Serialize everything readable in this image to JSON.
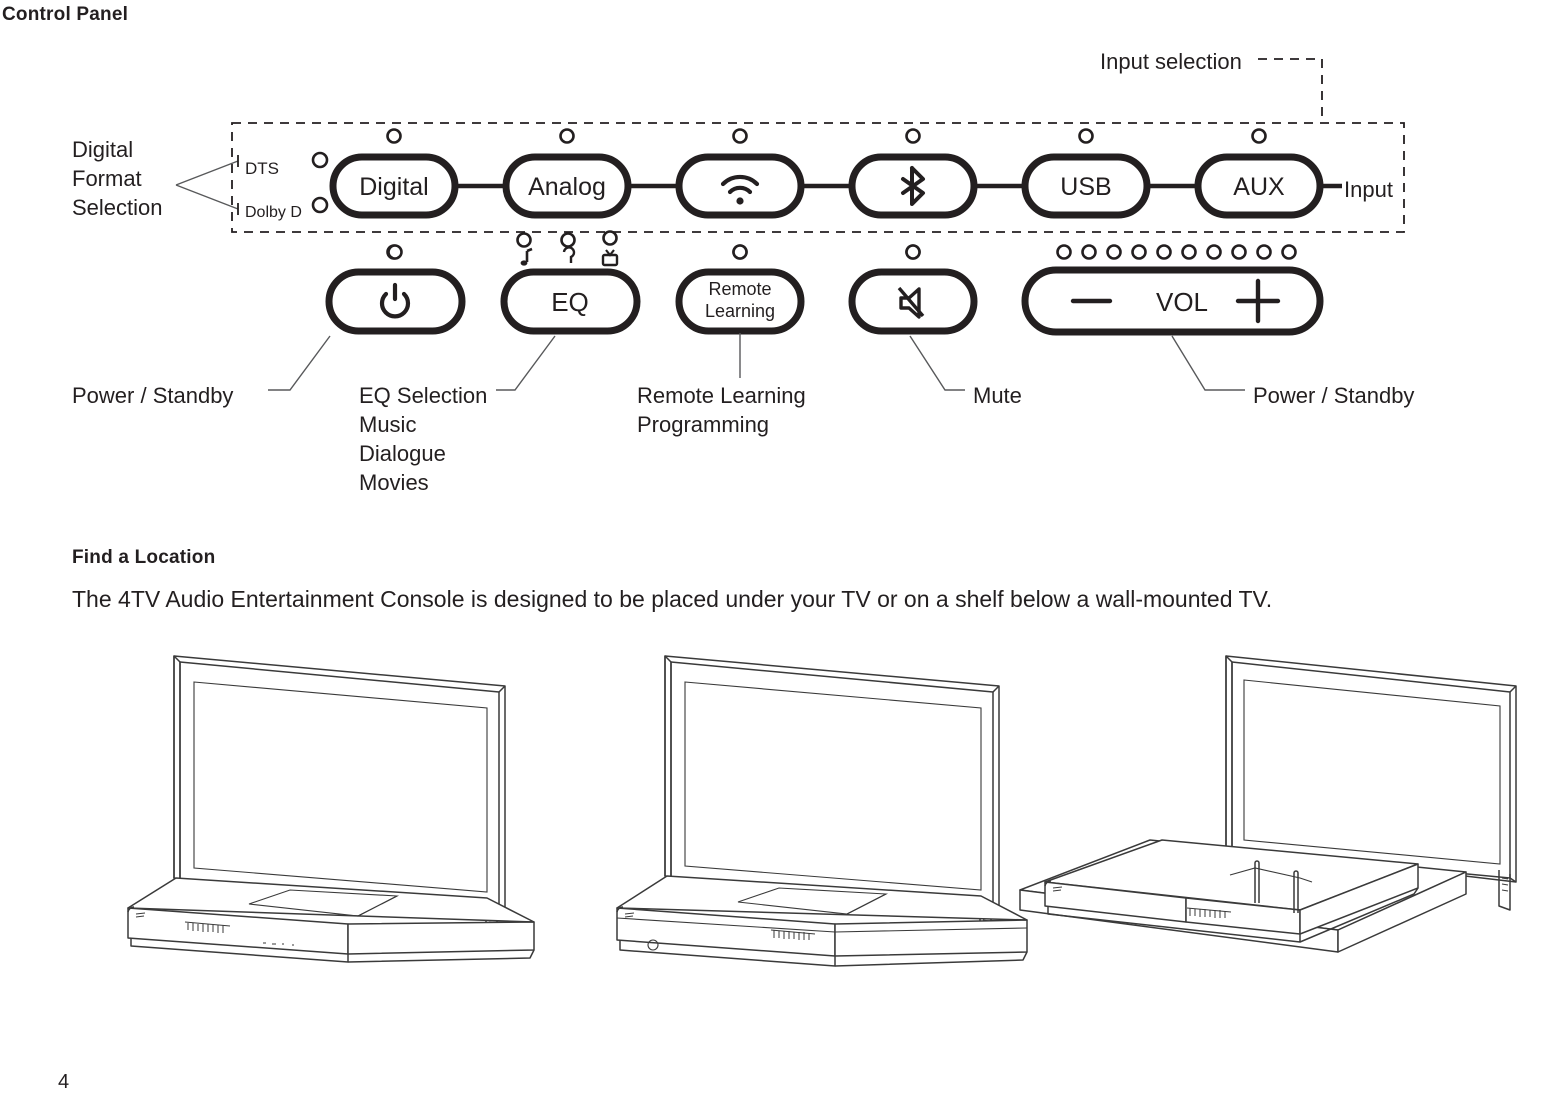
{
  "page": {
    "number": "4"
  },
  "sections": {
    "control_panel": {
      "heading": "Control Panel"
    },
    "find_location": {
      "heading": "Find a Location",
      "body": "The 4TV Audio Entertainment Console is designed to be placed under your TV or on a shelf below a wall-mounted TV."
    }
  },
  "control_panel": {
    "input_selection_label": "Input selection",
    "input_label": "Input",
    "digital_format_selection_label": "Digital\nFormat\nSelection",
    "format_indicators": [
      {
        "label": "DTS",
        "name": "dts-indicator"
      },
      {
        "label": "Dolby D",
        "name": "dolby-d-indicator"
      }
    ],
    "input_buttons": [
      {
        "label": "Digital",
        "icon": "text",
        "name": "digital-input-button"
      },
      {
        "label": "Analog",
        "icon": "text",
        "name": "analog-input-button"
      },
      {
        "label": "",
        "icon": "wifi-icon",
        "name": "wifi-input-button"
      },
      {
        "label": "",
        "icon": "bluetooth-icon",
        "name": "bluetooth-input-button"
      },
      {
        "label": "USB",
        "icon": "text",
        "name": "usb-input-button"
      },
      {
        "label": "AUX",
        "icon": "text",
        "name": "aux-input-button"
      }
    ],
    "control_buttons": [
      {
        "label": "",
        "icon": "power-icon",
        "name": "power-standby-button"
      },
      {
        "label": "EQ",
        "icon": "text",
        "name": "eq-button"
      },
      {
        "label": "Remote\nLearning",
        "icon": "text",
        "name": "remote-learning-button"
      },
      {
        "label": "",
        "icon": "mute-icon",
        "name": "mute-button"
      },
      {
        "label": "VOL",
        "icon": "volume",
        "name": "volume-button"
      }
    ],
    "volume_controls": {
      "minus": "—",
      "label": "VOL",
      "plus": "+",
      "led_count": 10
    },
    "eq_indicator_icons": [
      {
        "name": "music-note-icon",
        "meaning": "Music"
      },
      {
        "name": "dialogue-icon",
        "meaning": "Dialogue"
      },
      {
        "name": "tv-icon",
        "meaning": "Movies"
      }
    ],
    "callouts": [
      {
        "name": "callout-power-standby-left",
        "text": "Power / Standby"
      },
      {
        "name": "callout-eq-selection",
        "text": "EQ Selection\nMusic\nDialogue\nMovies"
      },
      {
        "name": "callout-remote-learning",
        "text": "Remote Learning\nProgramming"
      },
      {
        "name": "callout-mute",
        "text": "Mute"
      },
      {
        "name": "callout-power-standby-right",
        "text": "Power / Standby"
      }
    ]
  },
  "colors": {
    "ink": "#231f20",
    "line": "#58595b",
    "background": "#ffffff"
  }
}
